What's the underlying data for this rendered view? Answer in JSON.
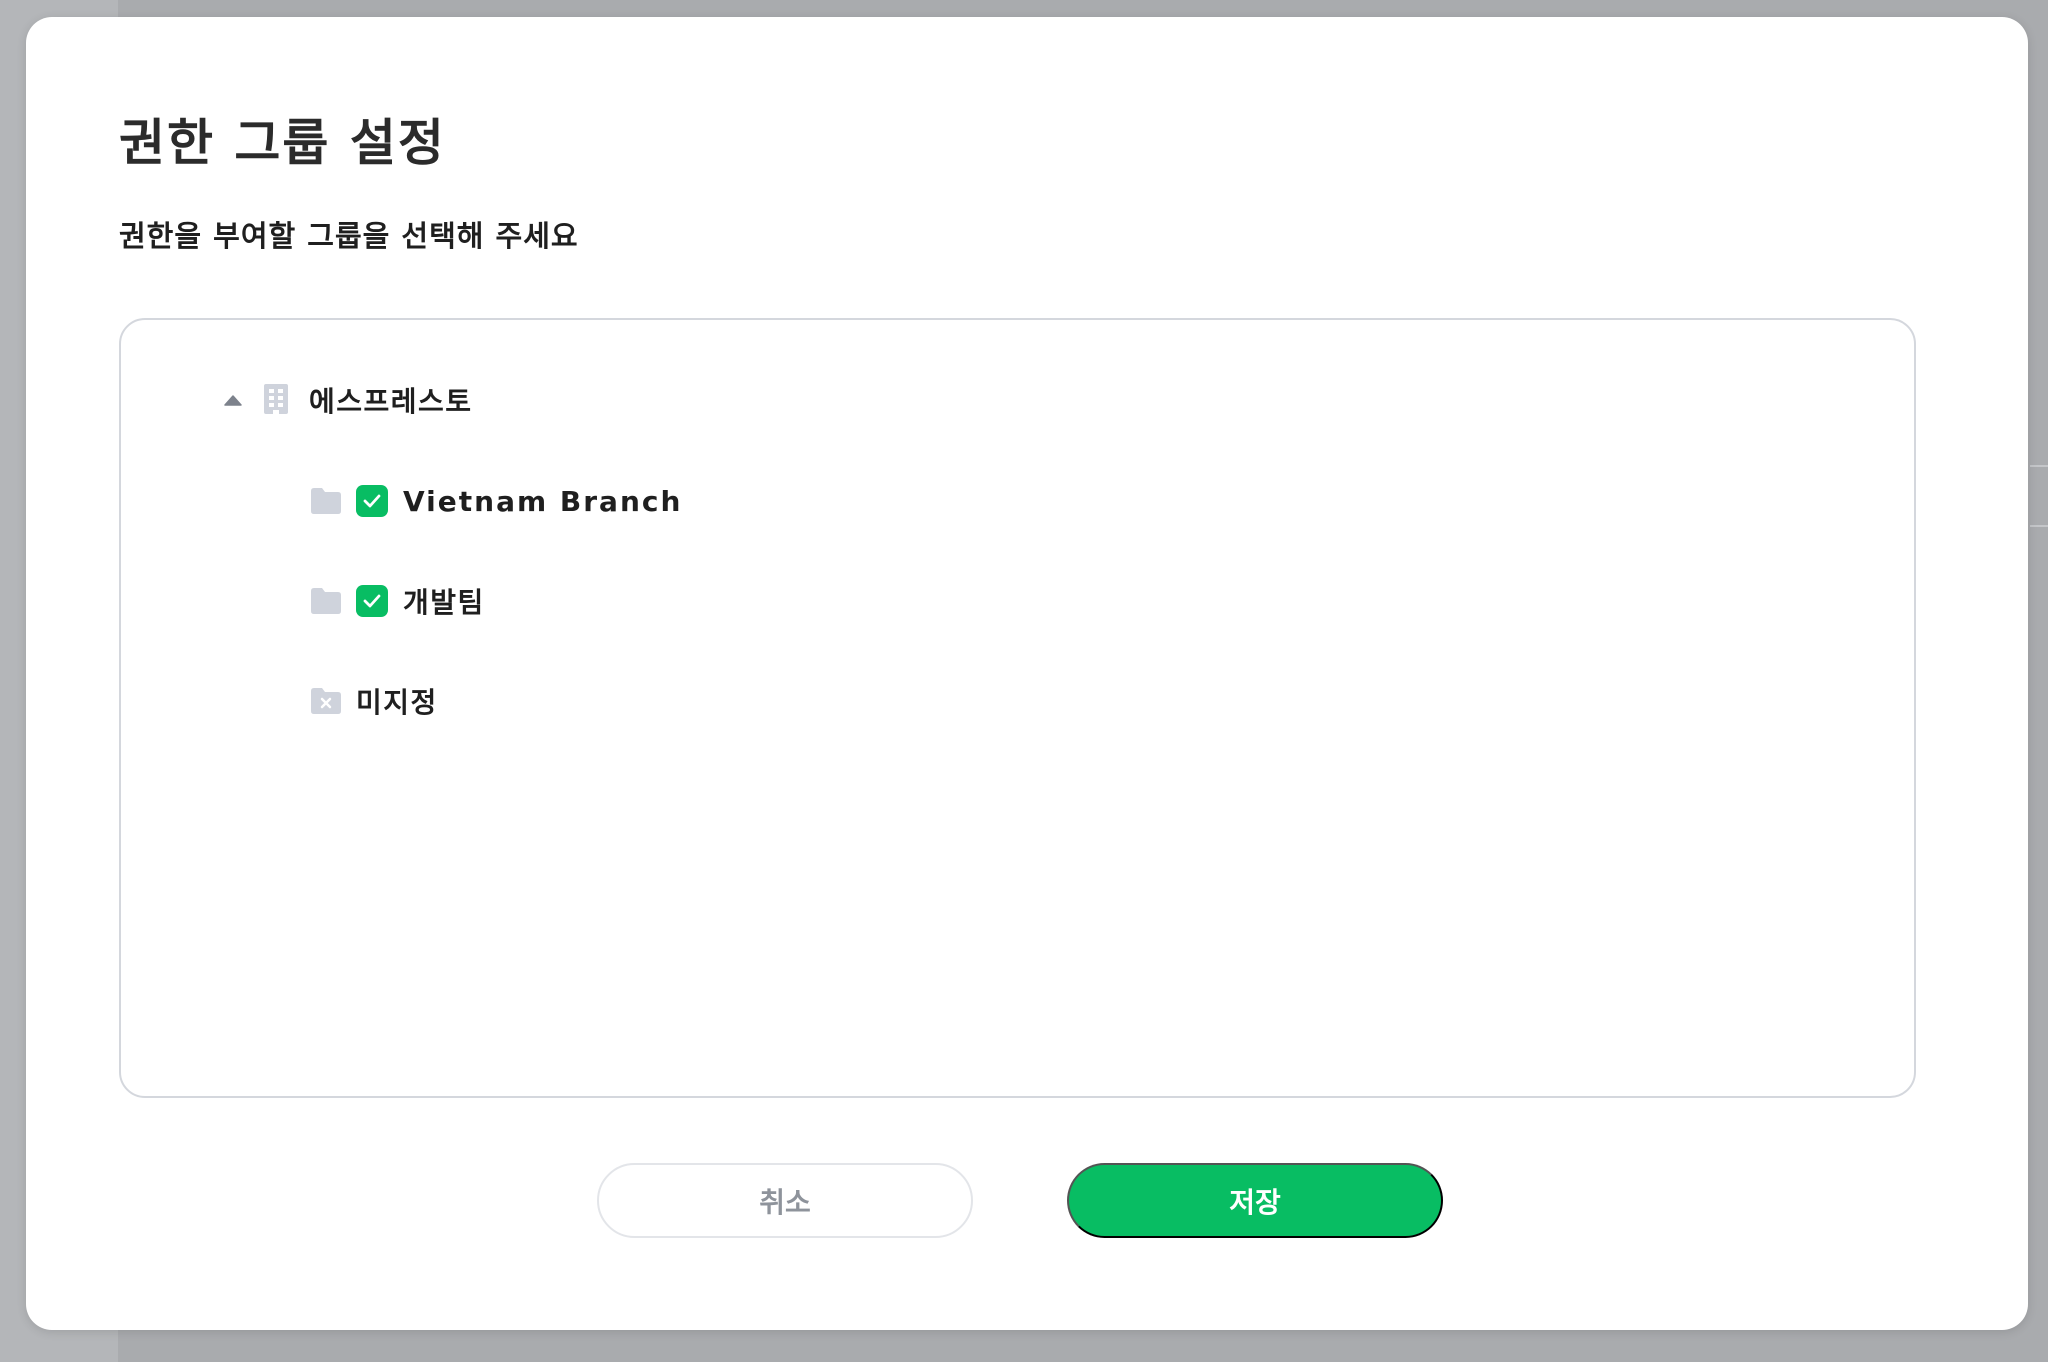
{
  "colors": {
    "accent": "#08bd63",
    "icon_gray": "#cfd3dc",
    "text_dark": "#1f1f1f",
    "cancel_text": "#8e939b"
  },
  "dialog": {
    "title": "권한 그룹 설정",
    "subtitle": "권한을 부여할 그룹을 선택해 주세요"
  },
  "tree": {
    "root": {
      "label": "에스프레스토",
      "expanded": true,
      "toggle_icon": "caret-up-icon",
      "icon": "building-icon"
    },
    "children": [
      {
        "label": "Vietnam Branch",
        "icon": "folder-icon",
        "checked": true
      },
      {
        "label": "개발팀",
        "icon": "folder-icon",
        "checked": true
      },
      {
        "label": "미지정",
        "icon": "folder-x-icon",
        "checked": false
      }
    ]
  },
  "buttons": {
    "cancel_label": "취소",
    "save_label": "저장"
  }
}
